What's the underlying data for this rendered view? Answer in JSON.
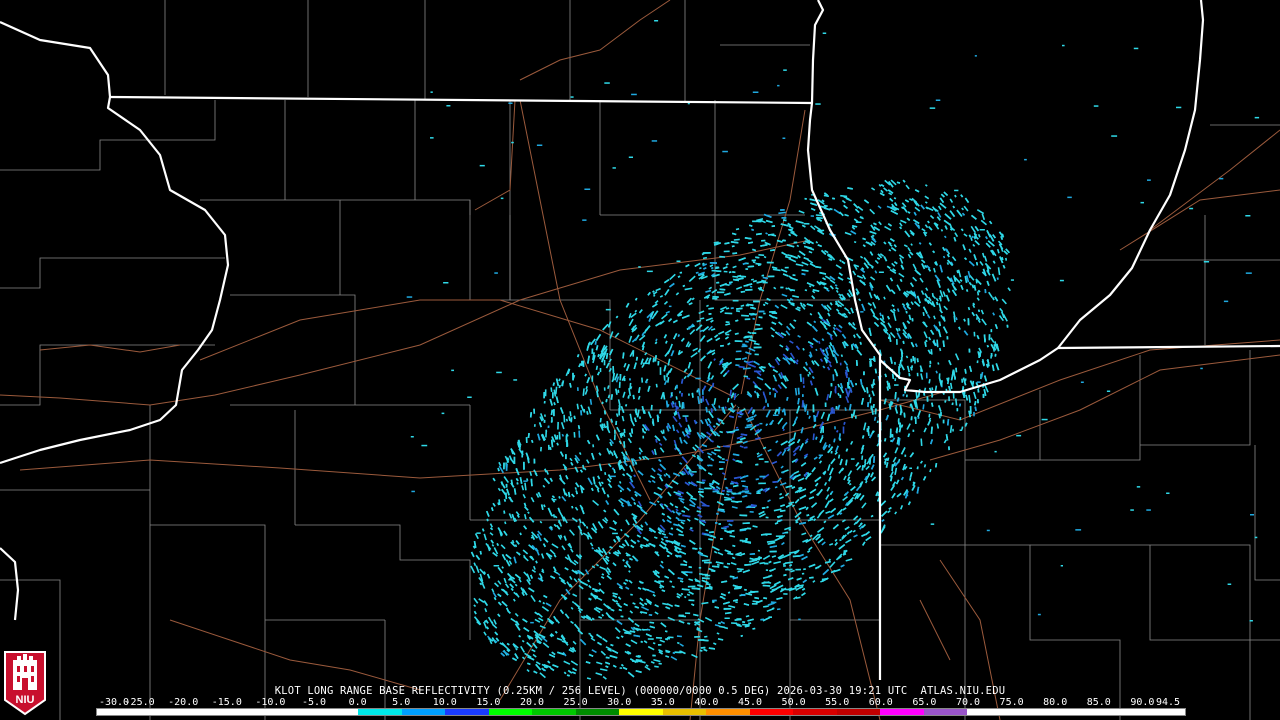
{
  "caption": {
    "radar": "KLOT",
    "product": "LONG RANGE BASE REFLECTIVITY",
    "resolution": "(0.25KM / 256 LEVEL)",
    "volume": "(000000/0000 0.5 DEG)",
    "timestamp": "2026-03-30 19:21 UTC",
    "source": "ATLAS.NIU.EDU"
  },
  "logo": {
    "text": "NIU",
    "colors": {
      "red": "#c8102e",
      "white": "#ffffff"
    }
  },
  "colorbar": {
    "labels": [
      "-30.0",
      "-25.0",
      "-20.0",
      "-15.0",
      "-10.0",
      "-5.0",
      "0.0",
      "5.0",
      "10.0",
      "15.0",
      "20.0",
      "25.0",
      "30.0",
      "35.0",
      "40.0",
      "45.0",
      "50.0",
      "55.0",
      "60.0",
      "65.0",
      "70.0",
      "75.0",
      "80.0",
      "85.0",
      "90.0",
      "94.5"
    ],
    "swatches": [
      "#ffffff",
      "#ffffff",
      "#ffffff",
      "#ffffff",
      "#ffffff",
      "#ffffff",
      "#00e8e8",
      "#00a0ff",
      "#1a3cff",
      "#00ff00",
      "#00c800",
      "#008c00",
      "#ffff00",
      "#e8c000",
      "#ff9000",
      "#ff0000",
      "#d80000",
      "#c00000",
      "#ff00ff",
      "#9955c9",
      "#ffffff",
      "#ffffff",
      "#ffffff",
      "#ffffff",
      "#ffffff"
    ]
  },
  "map_colors": {
    "background": "#000000",
    "state_border": "#ffffff",
    "county_border": "#8a8a8a",
    "highway": "#9b5a3c",
    "echo_light": "#2fd9e8",
    "echo_mid": "#1fa9e0",
    "echo_dark": "#2a55d0",
    "radar_site": "#000000"
  }
}
